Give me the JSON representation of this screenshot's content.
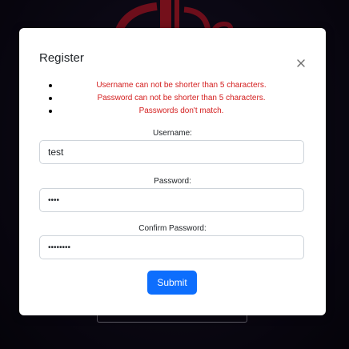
{
  "modal": {
    "title": "Register",
    "errors": [
      "Username can not be shorter than 5 characters.",
      "Password can not be shorter than 5 characters.",
      "Passwords don't match."
    ],
    "username": {
      "label": "Username:",
      "value": "test"
    },
    "password": {
      "label": "Password:",
      "value": "1234"
    },
    "confirm_password": {
      "label": "Confirm Password:",
      "value": "12345678"
    },
    "submit_label": "Submit"
  },
  "colors": {
    "error": "#d42020",
    "primary": "#0d6efd",
    "logo": "#b31a2a",
    "background": "#0e0b19"
  },
  "icons": {
    "close": "close-icon",
    "background_logo": "logo-icon"
  }
}
